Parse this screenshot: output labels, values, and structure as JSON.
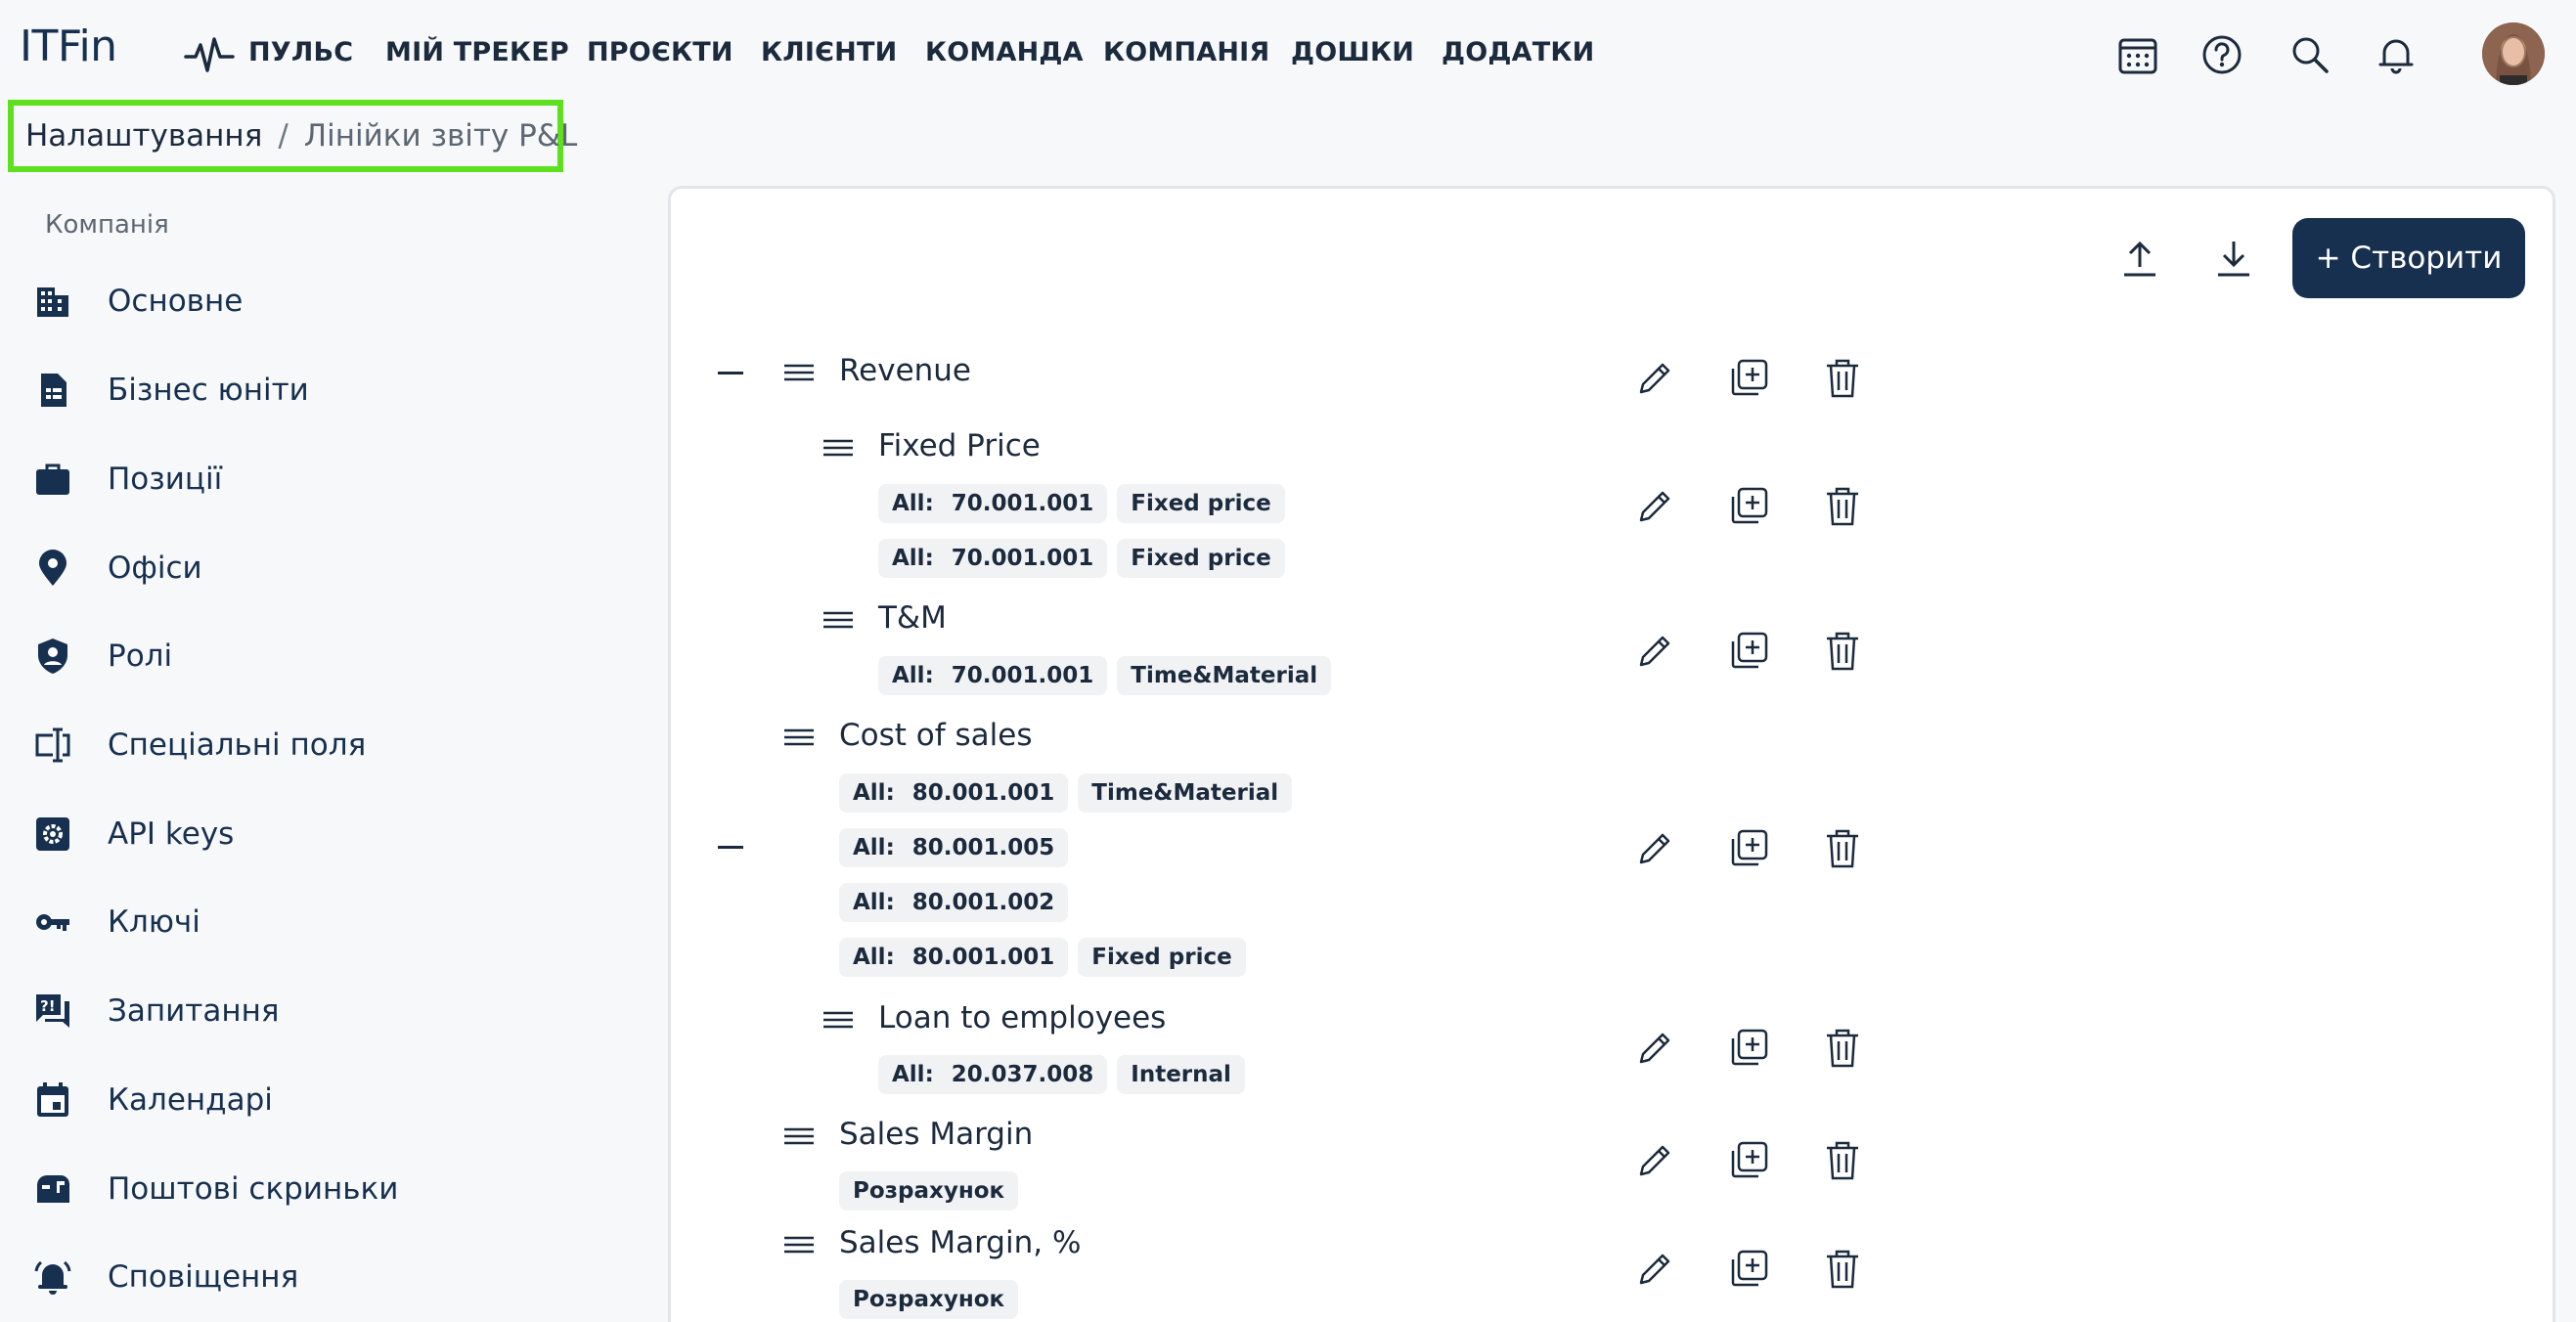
{
  "app": {
    "logo": "ITFin"
  },
  "nav": {
    "pulse": "ПУЛЬС",
    "tracker": "МІЙ ТРЕКЕР",
    "projects": "ПРОЄКТИ",
    "clients": "КЛІЄНТИ",
    "team": "КОМАНДА",
    "company": "КОМПАНІЯ",
    "boards": "ДОШКИ",
    "addons": "ДОДАТКИ"
  },
  "breadcrumb": {
    "root": "Налаштування",
    "separator": "/",
    "current": "Лінійки звіту P&L"
  },
  "sidebar": {
    "group": "Компанія",
    "items": [
      {
        "label": "Основне",
        "icon": "building-icon"
      },
      {
        "label": "Бізнес юніти",
        "icon": "document-icon"
      },
      {
        "label": "Позиції",
        "icon": "briefcase-icon"
      },
      {
        "label": "Офіси",
        "icon": "location-pin-icon"
      },
      {
        "label": "Ролі",
        "icon": "shield-user-icon"
      },
      {
        "label": "Спеціальні поля",
        "icon": "text-field-icon"
      },
      {
        "label": "API keys",
        "icon": "gear-icon"
      },
      {
        "label": "Ключі",
        "icon": "key-icon"
      },
      {
        "label": "Запитання",
        "icon": "question-chat-icon"
      },
      {
        "label": "Календарі",
        "icon": "calendar-icon"
      },
      {
        "label": "Поштові скриньки",
        "icon": "mailbox-icon"
      },
      {
        "label": "Сповіщення",
        "icon": "bell-ring-icon"
      }
    ]
  },
  "toolbar": {
    "create_label": "+ Створити"
  },
  "rows": {
    "revenue": {
      "title": "Revenue"
    },
    "fixed_price": {
      "title": "Fixed Price",
      "chips": [
        {
          "k": "All:",
          "v": "70.001.001",
          "tag": "Fixed price"
        },
        {
          "k": "All:",
          "v": "70.001.001",
          "tag": "Fixed price"
        }
      ]
    },
    "tm": {
      "title": "T&M",
      "chips": [
        {
          "k": "All:",
          "v": "70.001.001",
          "tag": "Time&Material"
        }
      ]
    },
    "cost_of_sales": {
      "title": "Cost of sales",
      "chips": [
        {
          "k": "All:",
          "v": "80.001.001",
          "tag": "Time&Material"
        },
        {
          "k": "All:",
          "v": "80.001.005"
        },
        {
          "k": "All:",
          "v": "80.001.002"
        },
        {
          "k": "All:",
          "v": "80.001.001",
          "tag": "Fixed price"
        }
      ]
    },
    "loan": {
      "title": "Loan to employees",
      "chips": [
        {
          "k": "All:",
          "v": "20.037.008",
          "tag": "Internal"
        }
      ]
    },
    "sales_margin": {
      "title": "Sales Margin",
      "tag": "Розрахунок"
    },
    "sales_margin_pct": {
      "title": "Sales Margin, %",
      "tag": "Розрахунок"
    }
  }
}
